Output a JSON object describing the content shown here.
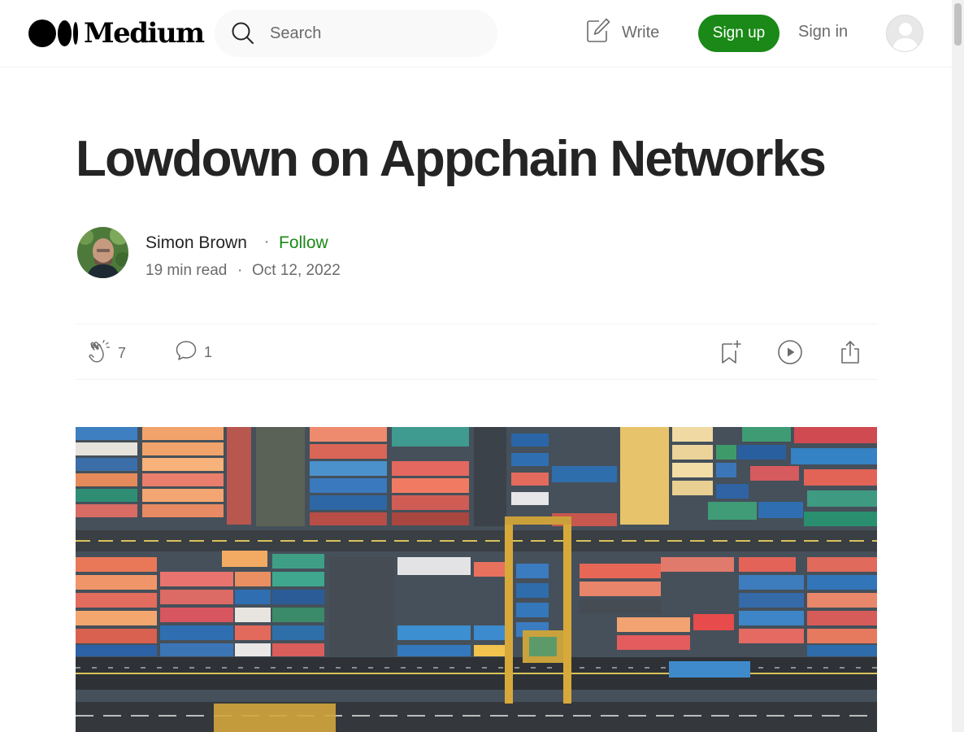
{
  "header": {
    "logo_text": "Medium",
    "search_placeholder": "Search",
    "write_label": "Write",
    "signup_label": "Sign up",
    "signin_label": "Sign in"
  },
  "article": {
    "title": "Lowdown on Appchain Networks",
    "author": "Simon Brown",
    "separator": "·",
    "follow_label": "Follow",
    "read_time": "19 min read",
    "date": "Oct 12, 2022",
    "claps": "7",
    "responses": "1"
  },
  "colors": {
    "accent_green": "#1a8917",
    "text_primary": "#242424",
    "text_secondary": "#6b6b6b"
  },
  "icons": {
    "search": "search-icon",
    "write": "write-icon",
    "clap": "clap-icon",
    "comment": "comment-icon",
    "bookmark": "bookmark-icon",
    "listen": "play-icon",
    "share": "share-icon"
  }
}
